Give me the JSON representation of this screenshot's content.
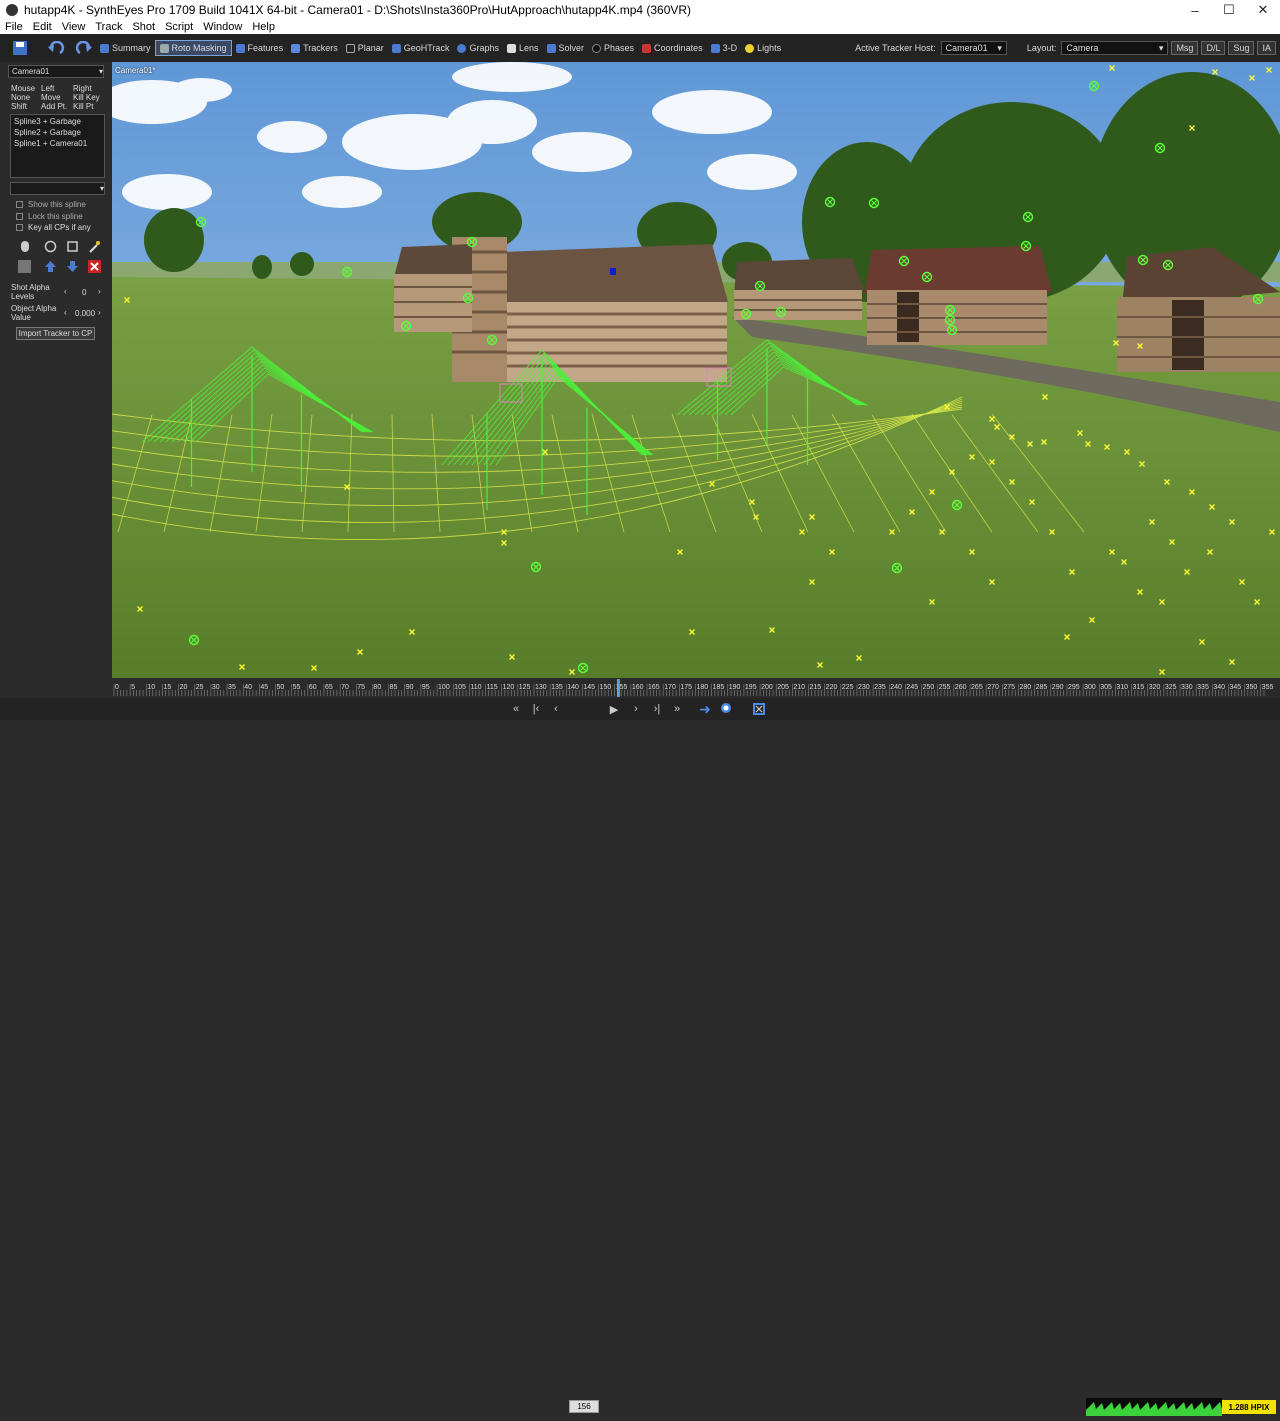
{
  "window": {
    "title": "hutapp4K - SynthEyes Pro 1709 Build 1041X 64-bit - Camera01 - D:\\Shots\\Insta360Pro\\HutApproach\\hutapp4K.mp4 (360VR)",
    "minimize": "–",
    "maximize": "☐",
    "close": "✕"
  },
  "menu": [
    "File",
    "Edit",
    "View",
    "Track",
    "Shot",
    "Script",
    "Window",
    "Help"
  ],
  "toolbar": {
    "rooms": [
      "Summary",
      "Roto Masking",
      "Features",
      "Trackers",
      "Planar",
      "GeoHTrack",
      "Graphs",
      "Lens",
      "Solver",
      "Phases",
      "Coordinates",
      "3-D",
      "Lights"
    ],
    "active_room": "Roto Masking",
    "active_tracker_host_label": "Active Tracker Host:",
    "active_tracker_host_value": "Camera01",
    "layout_label": "Layout:",
    "layout_value": "Camera",
    "right_buttons": [
      "Msg",
      "D/L",
      "Sug",
      "IA"
    ]
  },
  "sidebar": {
    "camera_select": "Camera01",
    "mouse_table": {
      "header": [
        "Mouse",
        "Left",
        "Right"
      ],
      "rows": [
        [
          "None",
          "Move",
          "Kill Key"
        ],
        [
          "Shift",
          "Add Pt.",
          "Kill Pt"
        ]
      ]
    },
    "splines": [
      "Spline3 + Garbage",
      "Spline2 + Garbage",
      "Spline1 + Camera01"
    ],
    "object_select": "",
    "show_spline": "Show this spline",
    "lock_spline": "Lock this spline",
    "key_all": "Key all CPs if any",
    "shot_alpha_label": "Shot Alpha Levels",
    "shot_alpha_value": "0",
    "object_alpha_label": "Object Alpha Value",
    "object_alpha_value": "0.000",
    "import_button": "Import Tracker to CP"
  },
  "viewport": {
    "label": "Camera01*"
  },
  "timeline": {
    "ticks": [
      "0",
      "5",
      "10",
      "15",
      "20",
      "25",
      "30",
      "35",
      "40",
      "45",
      "50",
      "55",
      "60",
      "65",
      "70",
      "75",
      "80",
      "85",
      "90",
      "95",
      "100",
      "105",
      "110",
      "115",
      "120",
      "125",
      "130",
      "135",
      "140",
      "145",
      "150",
      "155",
      "160",
      "165",
      "170",
      "175",
      "180",
      "185",
      "190",
      "195",
      "200",
      "205",
      "210",
      "215",
      "220",
      "225",
      "230",
      "235",
      "240",
      "245",
      "250",
      "255",
      "260",
      "265",
      "270",
      "275",
      "280",
      "285",
      "290",
      "295",
      "300",
      "305",
      "310",
      "315",
      "320",
      "325",
      "330",
      "335",
      "340",
      "345",
      "350",
      "355"
    ],
    "current_frame": 156,
    "total_frames": 356
  },
  "transport": {
    "frame": "156",
    "hpix": "1.288 HPIX"
  },
  "colors": {
    "tracker_green": "#5cff3c",
    "tracker_yellow": "#ffff33",
    "active_room": "#3a4a66",
    "hpix_bg": "#f2e200"
  }
}
